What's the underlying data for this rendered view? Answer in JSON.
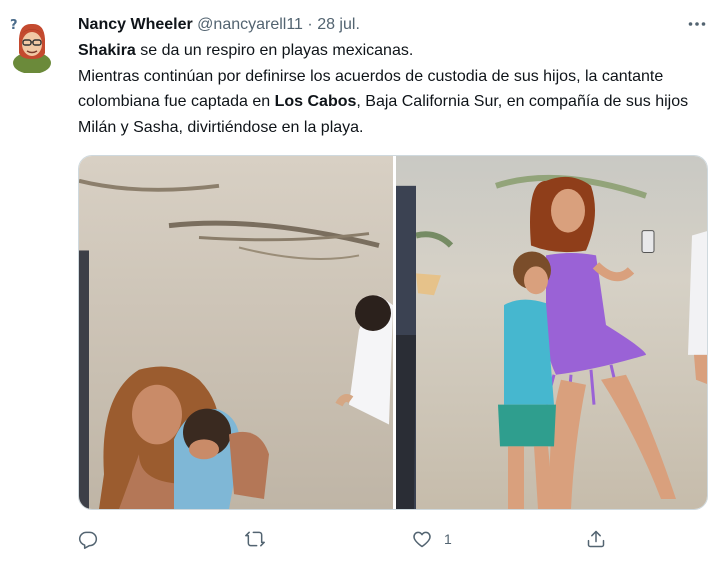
{
  "tweet": {
    "author_name": "Nancy Wheeler",
    "handle": "@nancyarell11",
    "separator": "·",
    "date": "28 jul.",
    "text_bold_1": "Shakira",
    "text_part_1": " se da un respiro en playas mexicanas.",
    "text_part_2": "Mientras continúan por definirse los acuerdos de custodia de sus hijos, la cantante colombiana fue captada en ",
    "text_bold_2": "Los Cabos",
    "text_part_3": ", Baja California Sur, en compañía de sus hijos Milán y Sasha, divirtiéndose en la playa.",
    "media": [
      {
        "icon": "beach-photo-mother-and-son"
      },
      {
        "icon": "beach-photo-woman-with-phone-and-boy"
      }
    ],
    "actions": {
      "reply_icon": "reply-icon",
      "retweet_icon": "retweet-icon",
      "like_icon": "heart-icon",
      "like_count": "1",
      "share_icon": "share-icon"
    },
    "colors": {
      "text": "#0f1419",
      "secondary": "#536471",
      "border": "#cfd9de"
    }
  }
}
